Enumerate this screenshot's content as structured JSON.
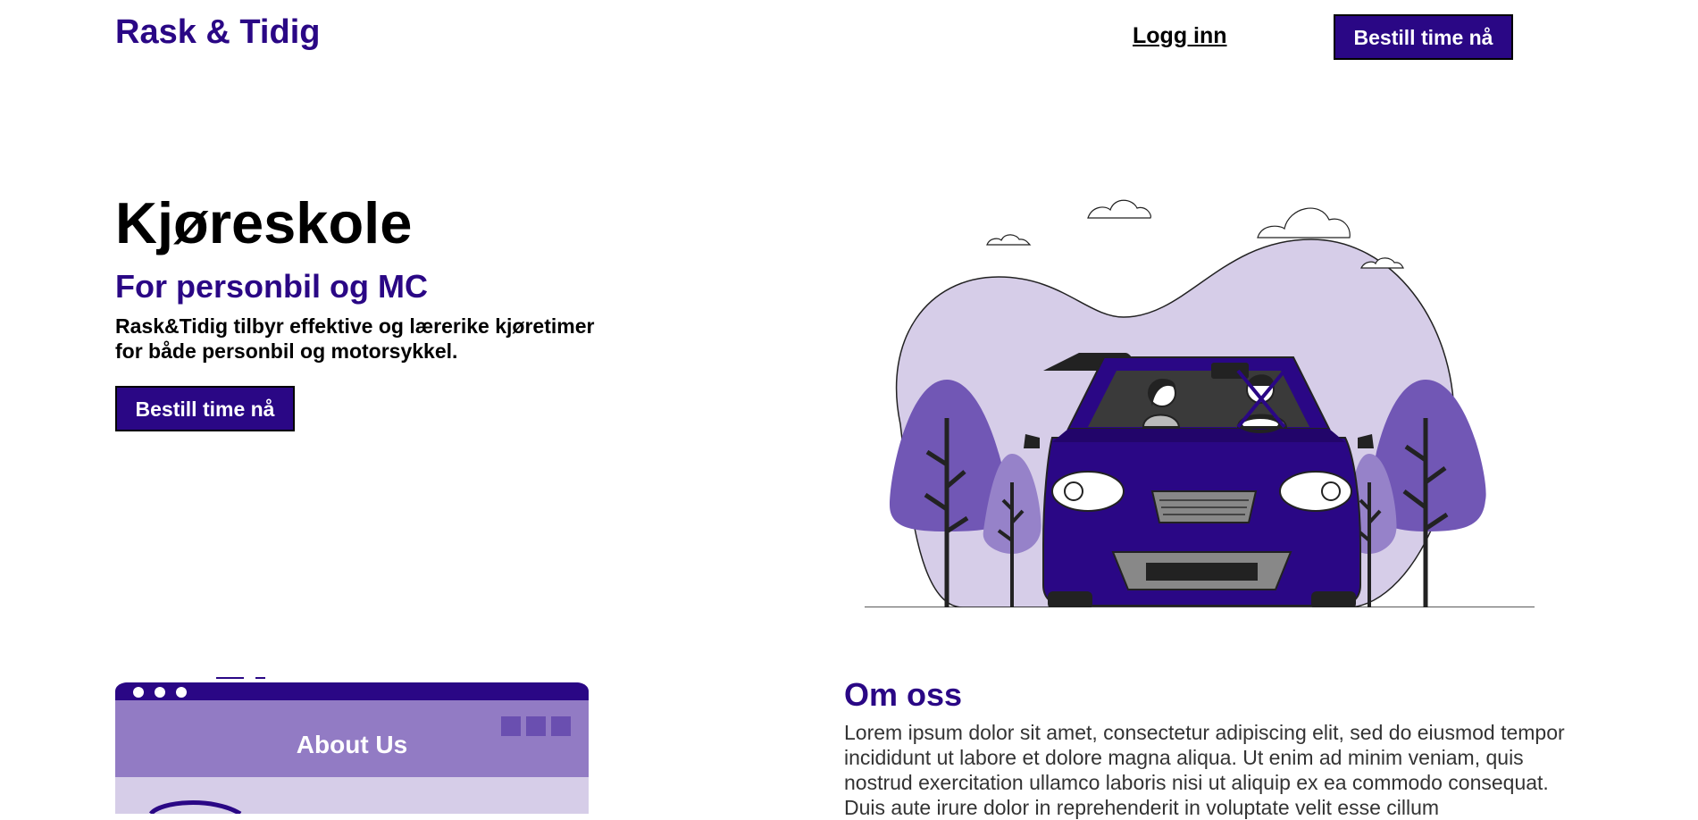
{
  "header": {
    "brand": "Rask & Tidig",
    "login_label": "Logg inn",
    "cta_label": "Bestill time nå"
  },
  "hero": {
    "title": "Kjøreskole",
    "subtitle": "For personbil og MC",
    "description": "Rask&Tidig tilbyr effektive og lærerike kjøretimer for både personbil og motorsykkel.",
    "cta_label": "Bestill time nå",
    "illustration_icon": "car-driving-illustration"
  },
  "about": {
    "illustration_text": "About Us",
    "title": "Om oss",
    "text": "Lorem ipsum dolor sit amet, consectetur adipiscing elit, sed do eiusmod tempor incididunt ut labore et dolore magna aliqua. Ut enim ad minim veniam, quis nostrud exercitation ullamco laboris nisi ut aliquip ex ea commodo consequat. Duis aute irure dolor in reprehenderit in voluptate velit esse cillum"
  },
  "colors": {
    "brand": "#2a0785",
    "light_purple": "#d6cde8",
    "mid_purple": "#7157b5",
    "about_header": "#927bc4"
  }
}
